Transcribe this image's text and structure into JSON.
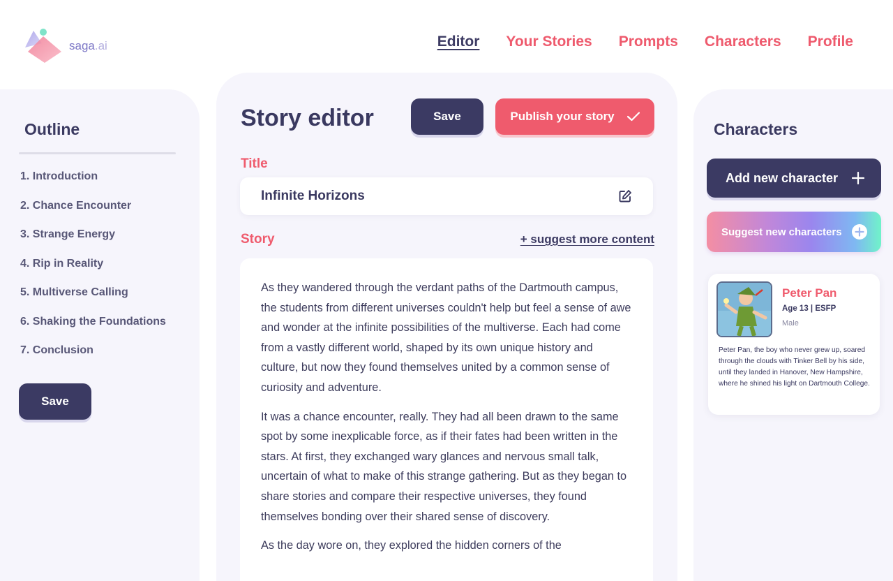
{
  "brand": {
    "name": "saga",
    "suffix": ".ai"
  },
  "nav": [
    {
      "label": "Editor",
      "active": true
    },
    {
      "label": "Your Stories"
    },
    {
      "label": "Prompts"
    },
    {
      "label": "Characters"
    },
    {
      "label": "Profile"
    }
  ],
  "outline": {
    "title": "Outline",
    "items": [
      "1. Introduction",
      "2. Chance Encounter",
      "3. Strange Energy",
      "4. Rip in Reality",
      "5. Multiverse Calling",
      "6. Shaking the Foundations",
      "7. Conclusion"
    ],
    "save_label": "Save"
  },
  "editor": {
    "heading": "Story editor",
    "save_label": "Save",
    "publish_label": "Publish your story",
    "title_label": "Title",
    "title_value": "Infinite Horizons",
    "story_label": "Story",
    "suggest_label": "+ suggest more content",
    "paragraphs": [
      "As they wandered through the verdant paths of the Dartmouth campus, the students from different universes couldn't help but feel a sense of awe and wonder at the infinite possibilities of the multiverse. Each had come from a vastly different world, shaped by its own unique history and culture, but now they found themselves united by a common sense of curiosity and adventure.",
      "It was a chance encounter, really. They had all been drawn to the same spot by some inexplicable force, as if their fates had been written in the stars. At first, they exchanged wary glances and nervous small talk, uncertain of what to make of this strange gathering. But as they began to share stories and compare their respective universes, they found themselves bonding over their shared sense of discovery.",
      "As the day wore on, they explored the hidden corners of the"
    ]
  },
  "characters": {
    "title": "Characters",
    "add_label": "Add new character",
    "suggest_label": "Suggest new characters",
    "cards": [
      {
        "name": "Peter Pan",
        "meta": "Age 13 | ESFP",
        "gender": "Male",
        "description": "Peter Pan, the boy who never grew up, soared through the clouds with Tinker Bell by his side, until they landed in Hanover, New Hampshire, where he shined his light on Dartmouth College."
      }
    ]
  },
  "colors": {
    "accent": "#ef5b6d",
    "navy": "#3b3a63",
    "panel": "#f6f5fc"
  }
}
